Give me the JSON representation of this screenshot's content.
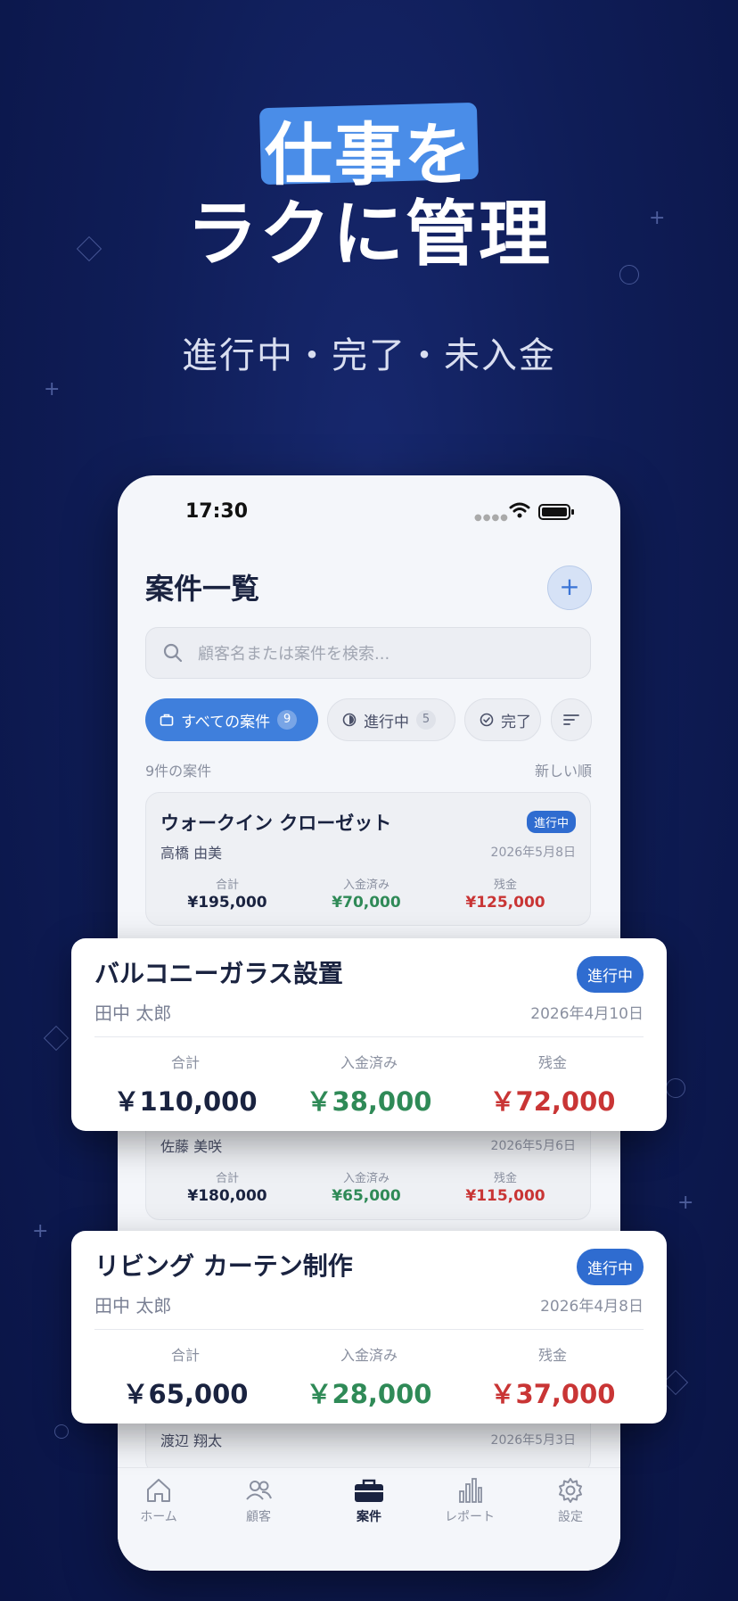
{
  "hero": {
    "line1": "仕事を",
    "line2": "ラクに管理",
    "subtitle": "進行中・完了・未入金"
  },
  "status_bar": {
    "time": "17:30"
  },
  "header": {
    "title": "案件一覧",
    "add_label": "+"
  },
  "search": {
    "placeholder": "顧客名または案件を検索..."
  },
  "filters": {
    "all": {
      "label": "すべての案件",
      "count": "9"
    },
    "in_progress": {
      "label": "進行中",
      "count": "5"
    },
    "done": {
      "label": "完了"
    }
  },
  "list_meta": {
    "count_label": "9件の案件",
    "sort_label": "新しい順"
  },
  "labels": {
    "total": "合計",
    "paid": "入金済み",
    "balance": "残金"
  },
  "colors": {
    "accent": "#3f7fdc",
    "badge": "#2f6cd0",
    "paid": "#2f8a57",
    "balance": "#c93535",
    "background": "#0f1d57"
  },
  "list_cards": [
    {
      "title": "ウォークイン クローゼット",
      "status": "進行中",
      "client": "高橋 由美",
      "date": "2026年5月8日",
      "total": "¥195,000",
      "paid": "¥70,000",
      "balance": "¥125,000"
    },
    {
      "client": "佐藤 美咲",
      "date": "2026年5月6日",
      "total": "¥180,000",
      "paid": "¥65,000",
      "balance": "¥115,000"
    },
    {
      "client": "渡辺 翔太",
      "date": "2026年5月3日"
    }
  ],
  "featured_cards": [
    {
      "title": "バルコニーガラス設置",
      "status": "進行中",
      "client": "田中 太郎",
      "date": "2026年4月10日",
      "total": "￥110,000",
      "paid": "￥38,000",
      "balance": "￥72,000"
    },
    {
      "title": "リビング カーテン制作",
      "status": "進行中",
      "client": "田中 太郎",
      "date": "2026年4月8日",
      "total": "￥65,000",
      "paid": "￥28,000",
      "balance": "￥37,000"
    }
  ],
  "tabs": [
    {
      "label": "ホーム",
      "icon": "home-icon"
    },
    {
      "label": "顧客",
      "icon": "people-icon"
    },
    {
      "label": "案件",
      "icon": "briefcase-icon",
      "active": true
    },
    {
      "label": "レポート",
      "icon": "bar-chart-icon"
    },
    {
      "label": "設定",
      "icon": "gear-icon"
    }
  ]
}
